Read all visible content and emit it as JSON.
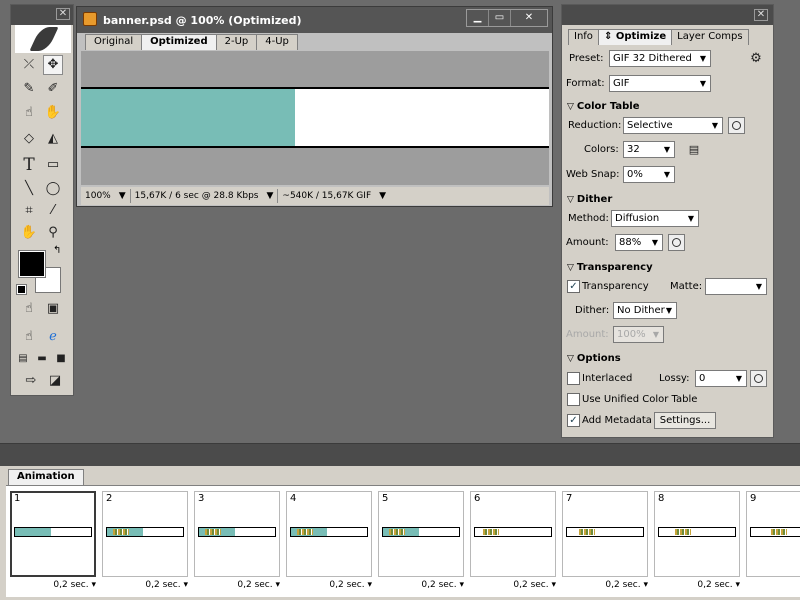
{
  "document": {
    "title": "banner.psd @ 100% (Optimized)",
    "tabs": [
      "Original",
      "Optimized",
      "2-Up",
      "4-Up"
    ],
    "active_tab": "Optimized",
    "status": {
      "zoom": "100%",
      "info1": "15,67K / 6 sec @ 28.8 Kbps",
      "info2": "~540K / 15,67K GIF"
    },
    "colors": {
      "banner_fill": "#78bdb6",
      "canvas_bg": "#9d9d9d"
    }
  },
  "optimize_panel": {
    "tabs": [
      "Info",
      "Optimize",
      "Layer Comps"
    ],
    "active_tab": "Optimize",
    "preset": {
      "label": "Preset:",
      "value": "GIF 32 Dithered"
    },
    "format": {
      "label": "Format:",
      "value": "GIF"
    },
    "color_table": {
      "title": "Color Table",
      "reduction": {
        "label": "Reduction:",
        "value": "Selective"
      },
      "colors": {
        "label": "Colors:",
        "value": "32"
      },
      "web_snap": {
        "label": "Web Snap:",
        "value": "0%"
      }
    },
    "dither": {
      "title": "Dither",
      "method": {
        "label": "Method:",
        "value": "Diffusion"
      },
      "amount": {
        "label": "Amount:",
        "value": "88%"
      }
    },
    "transparency": {
      "title": "Transparency",
      "checkbox_label": "Transparency",
      "checked": true,
      "matte_label": "Matte:",
      "matte_value": "",
      "dither": {
        "label": "Dither:",
        "value": "No Dither"
      },
      "amount": {
        "label": "Amount:",
        "value": "100%"
      }
    },
    "options": {
      "title": "Options",
      "interlaced": {
        "label": "Interlaced",
        "checked": false
      },
      "lossy": {
        "label": "Lossy:",
        "value": "0"
      },
      "unified": {
        "label": "Use Unified Color Table",
        "checked": false
      },
      "metadata": {
        "label": "Add Metadata",
        "checked": true
      },
      "settings_button": "Settings..."
    }
  },
  "animation": {
    "tab": "Animation",
    "frames": [
      {
        "number": "1",
        "delay": "0,2 sec.",
        "fill": 0.47,
        "selected": true
      },
      {
        "number": "2",
        "delay": "0,2 sec.",
        "fill": 0.47,
        "selected": false
      },
      {
        "number": "3",
        "delay": "0,2 sec.",
        "fill": 0.47,
        "selected": false
      },
      {
        "number": "4",
        "delay": "0,2 sec.",
        "fill": 0.47,
        "selected": false
      },
      {
        "number": "5",
        "delay": "0,2 sec.",
        "fill": 0.47,
        "selected": false
      },
      {
        "number": "6",
        "delay": "0,2 sec.",
        "fill": 0.0,
        "selected": false
      },
      {
        "number": "7",
        "delay": "0,2 sec.",
        "fill": 0.0,
        "selected": false
      },
      {
        "number": "8",
        "delay": "0,2 sec.",
        "fill": 0.0,
        "selected": false
      },
      {
        "number": "9",
        "delay": "",
        "fill": 0.0,
        "selected": false
      }
    ]
  },
  "tools": {
    "icons": [
      "marquee-icon",
      "move-icon",
      "lasso-icon",
      "magic-wand-icon",
      "crop-icon",
      "slice-icon",
      "healing-icon",
      "brush-icon",
      "eraser-icon",
      "paint-bucket-icon",
      "type-icon",
      "rectangle-icon",
      "line-icon",
      "ellipse-icon",
      "crop-tool-icon",
      "eyedropper-icon",
      "hand-icon",
      "zoom-icon"
    ]
  }
}
